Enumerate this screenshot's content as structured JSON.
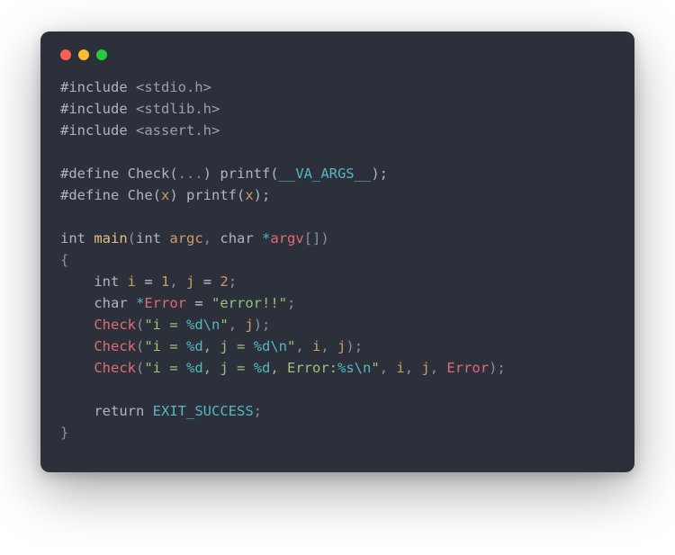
{
  "colors": {
    "bg": "#2c303a",
    "traffic_red": "#ff5f56",
    "traffic_yellow": "#ffbd2e",
    "traffic_green": "#27c93f",
    "keyword": "#b0b5bd",
    "function": "#e5c07b",
    "call_ident": "#e06c75",
    "identifier": "#d19a66",
    "number": "#d19a66",
    "string": "#98c379",
    "macro_const": "#56b6c2",
    "punct": "#8a8f98"
  },
  "code": {
    "raw": "#include <stdio.h>\n#include <stdlib.h>\n#include <assert.h>\n\n#define Check(...) printf(__VA_ARGS__);\n#define Che(x) printf(x);\n\nint main(int argc, char *argv[])\n{\n    int i = 1, j = 2;\n    char *Error = \"error!!\";\n    Check(\"i = %d\\n\", j);\n    Check(\"i = %d, j = %d\\n\", i, j);\n    Check(\"i = %d, j = %d, Error:%s\\n\", i, j, Error);\n\n    return EXIT_SUCCESS;\n}",
    "include1_dir": "#include",
    "include1_hdr": " <stdio.h>",
    "include2_dir": "#include",
    "include2_hdr": " <stdlib.h>",
    "include3_dir": "#include",
    "include3_hdr": " <assert.h>",
    "define1_a": "#define Check(",
    "define1_dots": "...",
    "define1_b": ") printf(",
    "define1_va": "__VA_ARGS__",
    "define1_c": ");",
    "define2_a": "#define Che(",
    "define2_x": "x",
    "define2_b": ") printf(",
    "define2_x2": "x",
    "define2_c": ");",
    "sig_int": "int",
    "sig_sp1": " ",
    "sig_main": "main",
    "sig_lp": "(",
    "sig_int2": "int",
    "sig_sp2": " ",
    "sig_argc": "argc",
    "sig_comma": ", ",
    "sig_char": "char",
    "sig_sp3": " ",
    "sig_star": "*",
    "sig_argv": "argv",
    "sig_brk": "[]",
    "sig_rp": ")",
    "lbrace": "{",
    "decl_indent": "    ",
    "decl_int": "int",
    "decl_sp": " ",
    "decl_i": "i",
    "decl_eq": " = ",
    "decl_1": "1",
    "decl_c1": ", ",
    "decl_j": "j",
    "decl_eq2": " = ",
    "decl_2": "2",
    "decl_semi": ";",
    "err_char": "char",
    "err_sp": " ",
    "err_star": "*",
    "err_name": "Error",
    "err_eq": " = ",
    "err_str": "\"error!!\"",
    "err_semi": ";",
    "chk_name": "Check",
    "chk_lp": "(",
    "chk1_s1": "\"i = ",
    "chk1_fd": "%d\\n",
    "chk1_s2": "\"",
    "chk1_c": ", ",
    "chk1_j": "j",
    "chk1_rp": ");",
    "chk2_s1": "\"i = ",
    "chk2_fd": "%d",
    "chk2_s2": ", j = ",
    "chk2_fd2": "%d\\n",
    "chk2_s3": "\"",
    "chk2_c1": ", ",
    "chk2_i": "i",
    "chk2_c2": ", ",
    "chk2_j": "j",
    "chk2_rp": ");",
    "chk3_s1": "\"i = ",
    "chk3_fd": "%d",
    "chk3_s2": ", j = ",
    "chk3_fd2": "%d",
    "chk3_s3": ", Error:",
    "chk3_fs": "%s\\n",
    "chk3_s4": "\"",
    "chk3_c1": ", ",
    "chk3_i": "i",
    "chk3_c2": ", ",
    "chk3_j": "j",
    "chk3_c3": ", ",
    "chk3_err": "Error",
    "chk3_rp": ");",
    "ret_kw": "return",
    "ret_sp": " ",
    "ret_const": "EXIT_SUCCESS",
    "ret_semi": ";",
    "rbrace": "}"
  }
}
